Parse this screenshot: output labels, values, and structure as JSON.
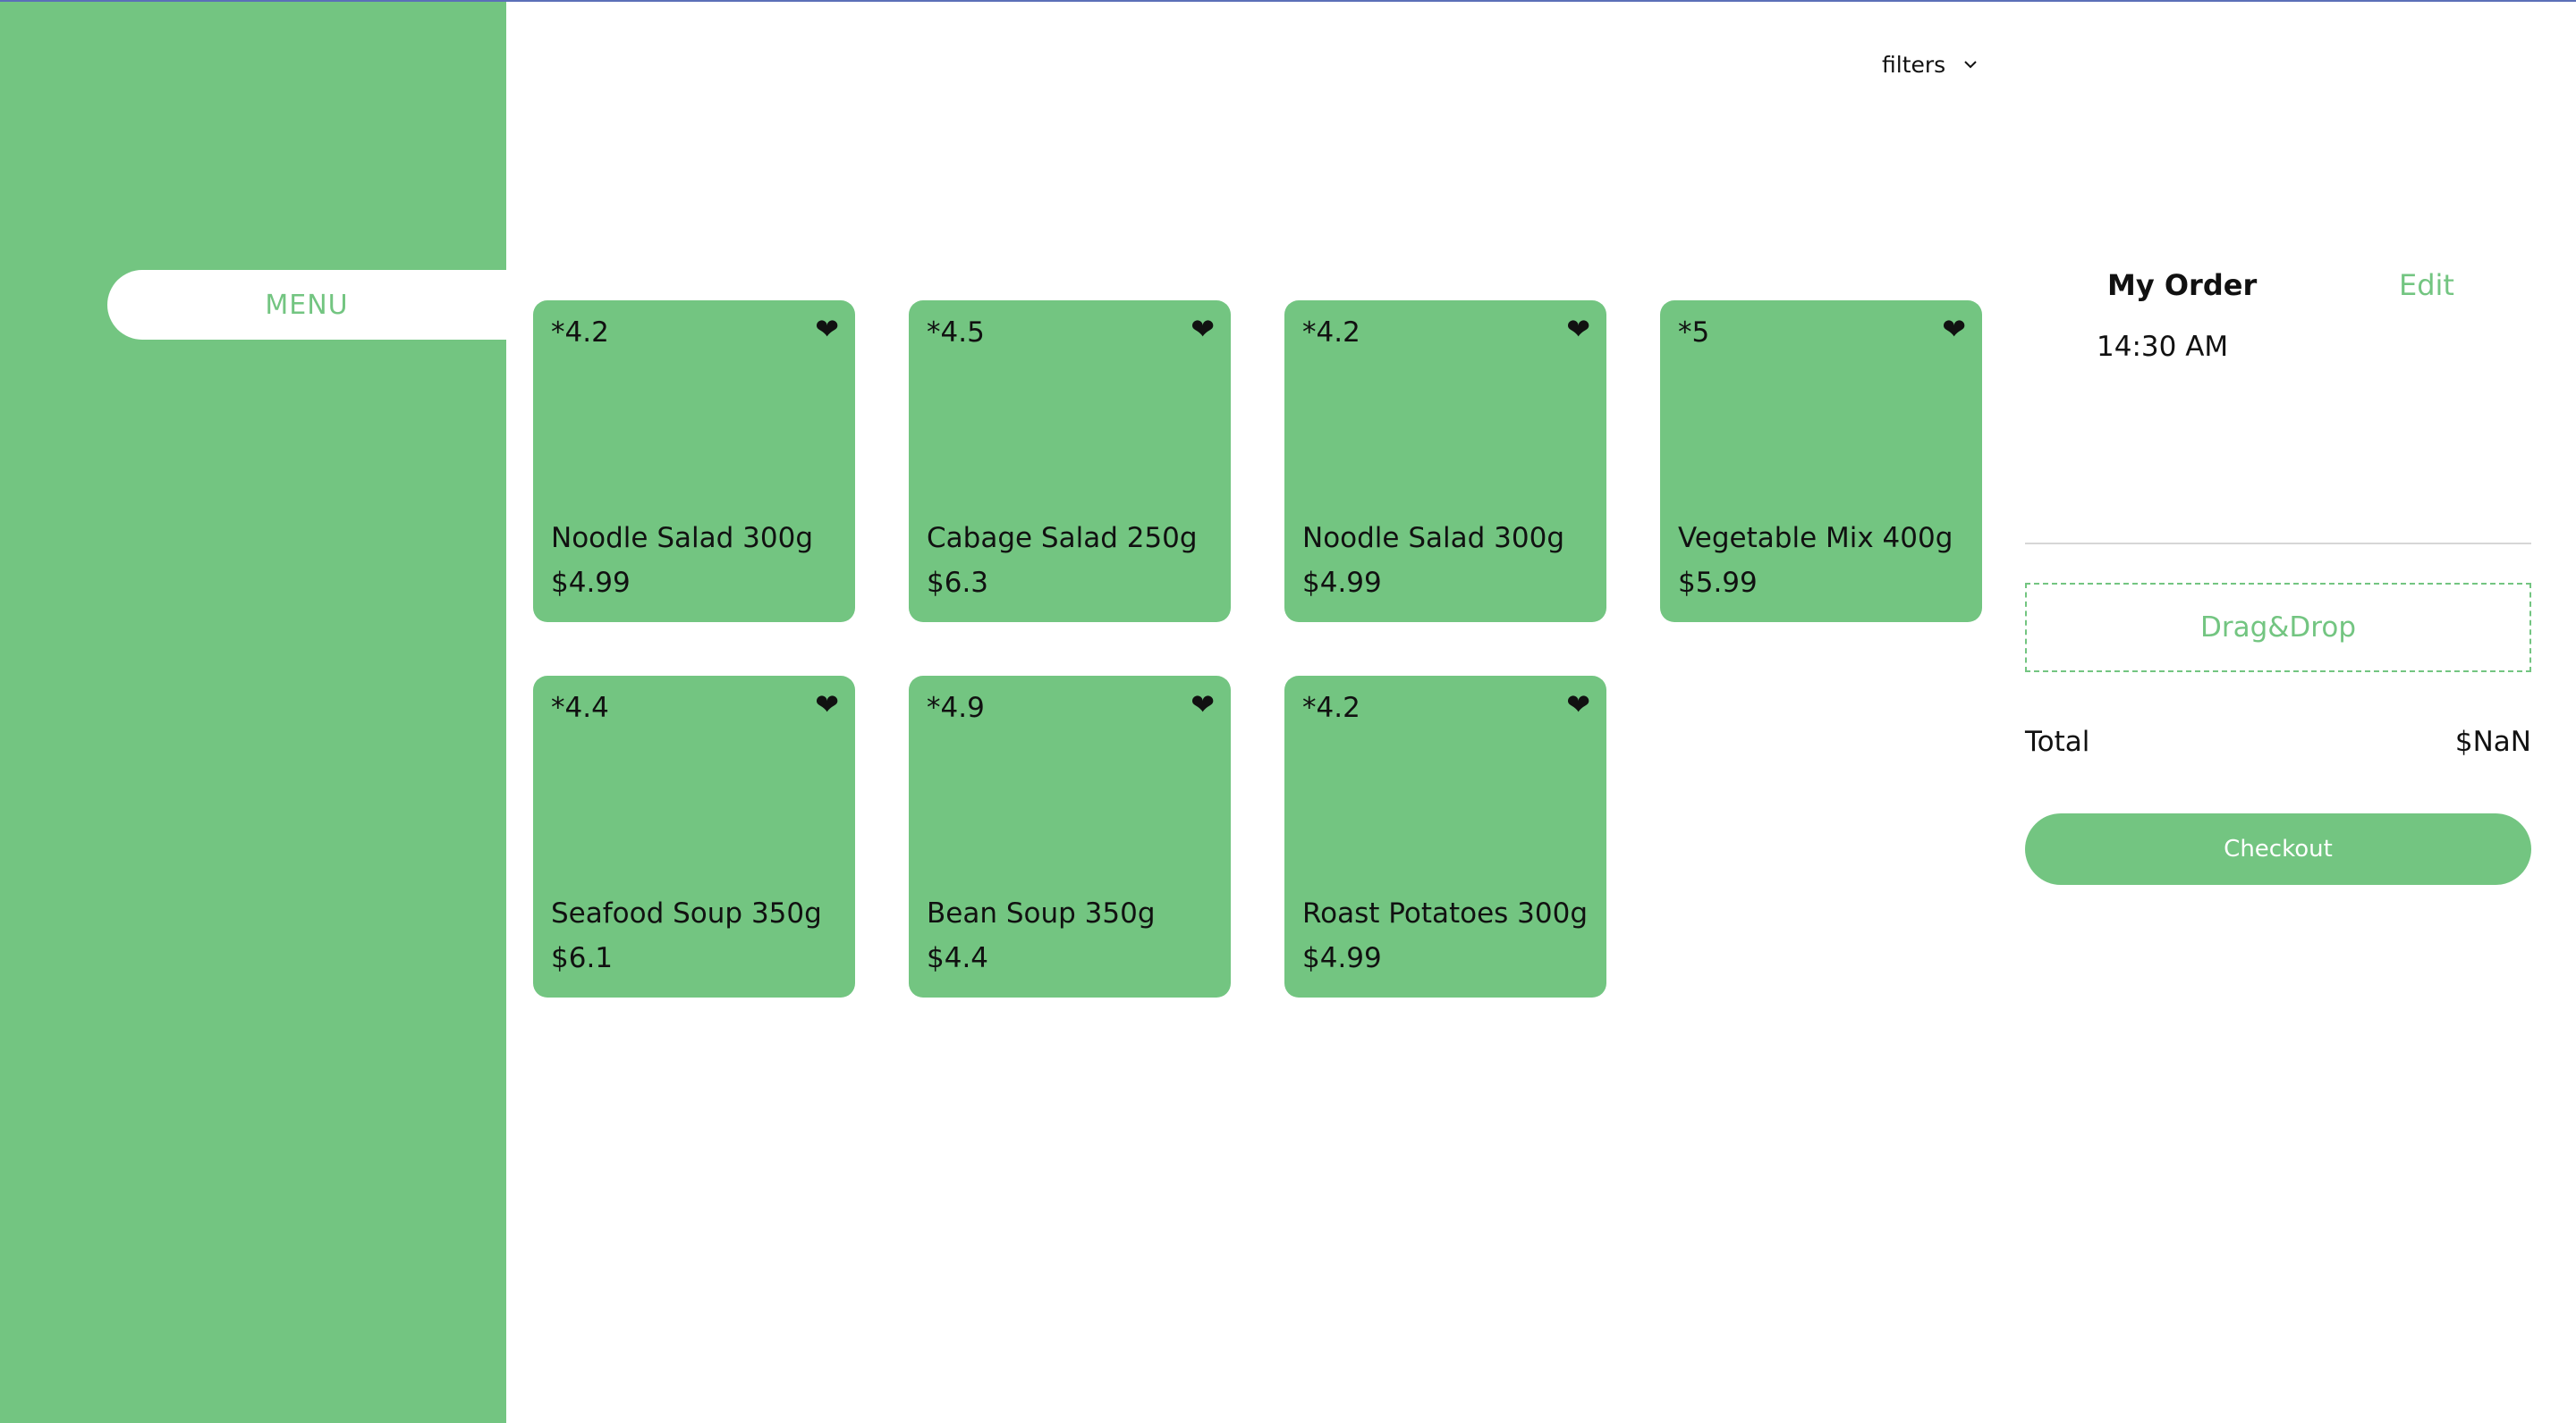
{
  "sidebar": {
    "menu_label": "MENU"
  },
  "toolbar": {
    "filters_label": "filters",
    "filters_icon": "chevron-down-icon"
  },
  "products": [
    {
      "rating": "*4.2",
      "name": "Noodle Salad 300g",
      "price": "$4.99",
      "favorite_icon": "heart-icon"
    },
    {
      "rating": "*4.5",
      "name": "Cabage Salad 250g",
      "price": "$6.3",
      "favorite_icon": "heart-icon"
    },
    {
      "rating": "*4.2",
      "name": "Noodle Salad 300g",
      "price": "$4.99",
      "favorite_icon": "heart-icon"
    },
    {
      "rating": "*5",
      "name": "Vegetable Mix 400g",
      "price": "$5.99",
      "favorite_icon": "heart-icon"
    },
    {
      "rating": "*4.4",
      "name": "Seafood Soup 350g",
      "price": "$6.1",
      "favorite_icon": "heart-icon"
    },
    {
      "rating": "*4.9",
      "name": "Bean Soup 350g",
      "price": "$4.4",
      "favorite_icon": "heart-icon"
    },
    {
      "rating": "*4.2",
      "name": "Roast Potatoes 300g",
      "price": "$4.99",
      "favorite_icon": "heart-icon"
    }
  ],
  "order": {
    "title": "My Order",
    "edit_label": "Edit",
    "time": "14:30 AM",
    "dropzone_label": "Drag&Drop",
    "total_label": "Total",
    "total_value": "$NaN",
    "checkout_label": "Checkout"
  },
  "colors": {
    "accent": "#73c581",
    "text": "#111111",
    "background": "#ffffff",
    "divider": "#d6d6d6"
  }
}
